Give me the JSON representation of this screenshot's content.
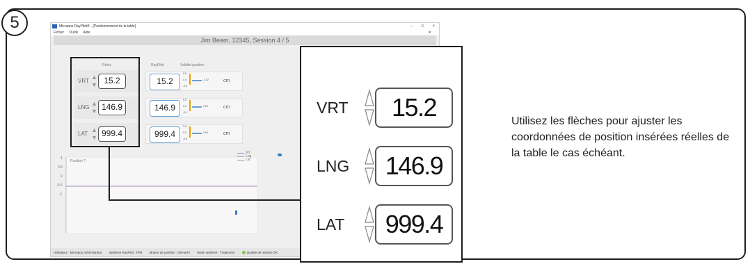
{
  "step_number": "5",
  "window": {
    "title": "Micropos RayPilot® - [Positionnement de la table]",
    "controls": [
      "–",
      "□",
      "×"
    ],
    "menu": [
      "Fichier",
      "Outils",
      "Aide"
    ],
    "menu_close": "×",
    "session": "Jim Beam, 12345, Session 4 / 5"
  },
  "panel": {
    "reels_header": "Réels",
    "raypilot_header": "RayPilot",
    "validite_header": "Validité position",
    "unit": "cm",
    "rows": [
      {
        "label": "VRT",
        "reel": "15.2",
        "raypilot": "15.2",
        "gauge_top": "0.5",
        "gauge_mid": "0.0",
        "gauge_bot": "-0.5",
        "delta": "-0.02"
      },
      {
        "label": "LNG",
        "reel": "146.9",
        "raypilot": "146.9",
        "gauge_top": "0.5",
        "gauge_mid": "0.0",
        "gauge_bot": "-0.5",
        "delta": "0.00"
      },
      {
        "label": "LAT",
        "reel": "999.4",
        "raypilot": "999.4",
        "gauge_top": "0.5",
        "gauge_mid": "0.0",
        "gauge_bot": "-0.5",
        "delta": "0.06"
      }
    ]
  },
  "plot": {
    "title": "Position ?",
    "yticks": [
      "1",
      "0.5",
      "0",
      "-0.5",
      "-1"
    ],
    "legend": [
      "Vrt",
      "Lng",
      "Lat"
    ]
  },
  "statusbar": {
    "user": "Utilisateur : Micropos Administrator",
    "system": "Système RayPilot : Prêt",
    "motor": "Moteur de position : Démarré",
    "mode": "Mode système : Traitement",
    "quality": "Qualité de mesure OK"
  },
  "zoom": [
    {
      "label": "VRT",
      "value": "15.2"
    },
    {
      "label": "LNG",
      "value": "146.9"
    },
    {
      "label": "LAT",
      "value": "999.4"
    }
  ],
  "description": "Utilisez les flèches pour ajuster les coordonnées de position insérées réelles de la table le cas échéant."
}
